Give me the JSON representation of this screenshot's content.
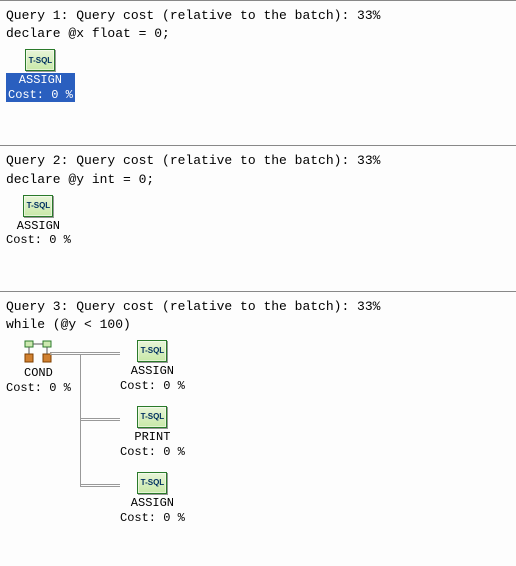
{
  "icon_text": "T-SQL",
  "queries": [
    {
      "header": "Query 1: Query cost (relative to the batch): 33%",
      "sql": "declare @x float = 0;",
      "ops": {
        "assign": {
          "label": "ASSIGN",
          "cost": "Cost: 0 %"
        }
      },
      "selected": true
    },
    {
      "header": "Query 2: Query cost (relative to the batch): 33%",
      "sql": "declare @y int = 0;",
      "ops": {
        "assign": {
          "label": "ASSIGN",
          "cost": "Cost: 0 %"
        }
      },
      "selected": false
    },
    {
      "header": "Query 3: Query cost (relative to the batch): 33%",
      "sql": "while (@y < 100)",
      "ops": {
        "cond": {
          "label": "COND",
          "cost": "Cost: 0 %"
        },
        "assign1": {
          "label": "ASSIGN",
          "cost": "Cost: 0 %"
        },
        "print": {
          "label": "PRINT",
          "cost": "Cost: 0 %"
        },
        "assign2": {
          "label": "ASSIGN",
          "cost": "Cost: 0 %"
        }
      }
    }
  ]
}
